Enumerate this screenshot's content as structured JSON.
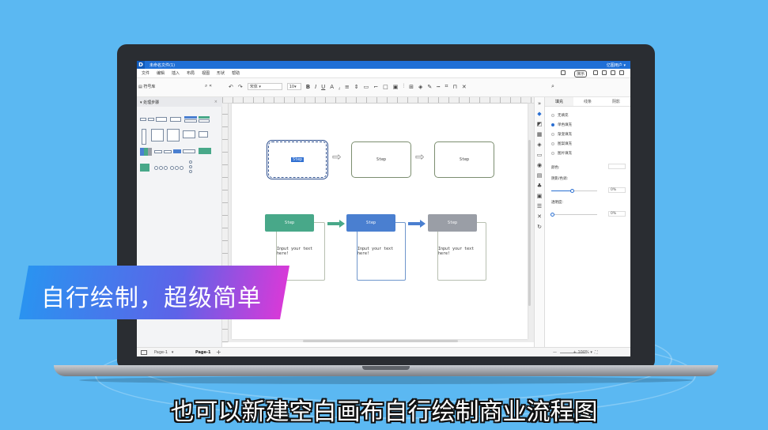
{
  "app": {
    "logo_glyph": "D",
    "doc_title": "未命名文件(1)",
    "user": "亿图用户 ▾"
  },
  "menu": {
    "items": [
      "文件",
      "编辑",
      "插入",
      "布局",
      "视图",
      "形状",
      "帮助"
    ],
    "present_label": "演示"
  },
  "toolbar": {
    "library_label": "符号库",
    "font": "宋体",
    "font_size": "10"
  },
  "library": {
    "category": "处理步骤"
  },
  "diagram": {
    "row1": [
      "Step",
      "Step",
      "Step"
    ],
    "row2_headers": [
      "Step",
      "Step",
      "Step"
    ],
    "row2_body": [
      "Input your text here!",
      "Input your text here!",
      "Input your text here!"
    ],
    "colors": {
      "green": "#48a889",
      "blue": "#4a7fd0",
      "grey": "#9a9ea6"
    }
  },
  "panel": {
    "tabs": [
      "填充",
      "线条",
      "阴影"
    ],
    "fill_options": [
      "无填充",
      "单色填充",
      "渐变填充",
      "图案填充",
      "图片填充"
    ],
    "selected_option": "单色填充",
    "color_label": "颜色:",
    "shade_label": "阴影/色调:",
    "shade_value": "0%",
    "transparency_label": "透明度:",
    "transparency_value": "0%"
  },
  "status": {
    "page_tab_1": "Page-1",
    "page_tab_2": "Page-1",
    "zoom": "100%"
  },
  "overlay": {
    "banner": "自行绘制，超级简单",
    "subtitle": "也可以新建空白画布自行绘制商业流程图"
  }
}
